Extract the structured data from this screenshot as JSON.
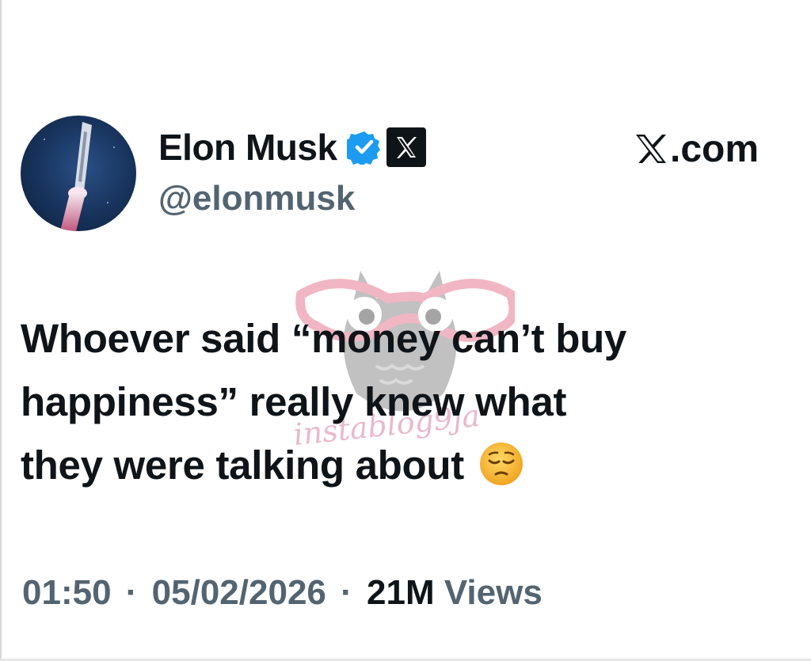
{
  "author": {
    "display_name": "Elon Musk",
    "handle": "@elonmusk",
    "verified_icon": "verified-badge-icon",
    "affiliate_icon": "x-logo-icon"
  },
  "brand": {
    "label": ".com",
    "logo_icon": "x-logo-icon"
  },
  "tweet": {
    "lines": [
      "Whoever said “money can’t buy",
      "happiness” really knew what",
      "they were talking about"
    ],
    "emoji": "pensive-face-icon"
  },
  "meta": {
    "time": "01:50",
    "date": "05/02/2026",
    "separator": "·",
    "views_count": "21M",
    "views_label": "Views"
  },
  "watermark": {
    "text": "instablog9ja"
  },
  "colors": {
    "text_primary": "#0f1419",
    "text_secondary": "#536471",
    "verified_blue": "#1d9bf0",
    "background": "#ffffff"
  }
}
